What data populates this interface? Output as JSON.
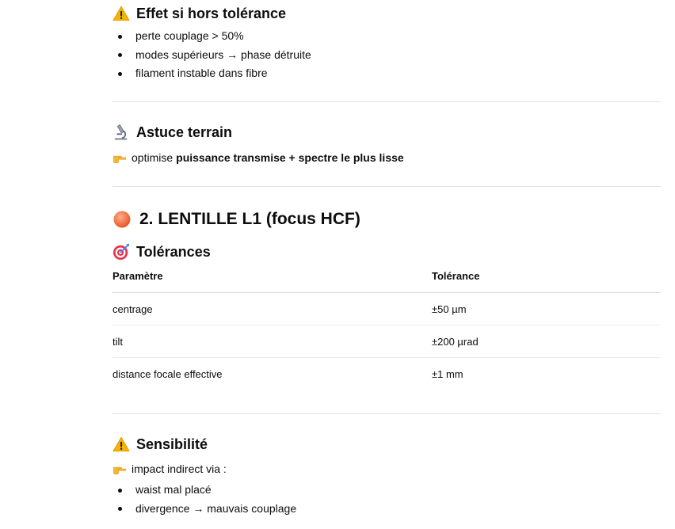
{
  "section_effect": {
    "title": "Effet si hors tolérance",
    "icon": "warning-icon",
    "items": [
      "perte couplage > 50%",
      "modes supérieurs → phase détruite",
      "filament instable dans fibre"
    ]
  },
  "section_tip": {
    "title": "Astuce terrain",
    "icon": "microscope-icon",
    "pointer_icon": "pointing-hand-icon",
    "text_prefix": "optimise ",
    "text_bold": "puissance transmise + spectre le plus lisse"
  },
  "section_lens": {
    "title": "2. LENTILLE L1 (focus HCF)",
    "icon": "orange-circle-icon"
  },
  "section_tolerances": {
    "title": "Tolérances",
    "icon": "target-icon",
    "headers": [
      "Paramètre",
      "Tolérance"
    ],
    "rows": [
      [
        "centrage",
        "±50 µm"
      ],
      [
        "tilt",
        "±200 µrad"
      ],
      [
        "distance focale effective",
        "±1 mm"
      ]
    ]
  },
  "section_sensitivity": {
    "title": "Sensibilité",
    "icon": "warning-icon",
    "pointer_icon": "pointing-hand-icon",
    "intro": "impact indirect via :",
    "items": [
      "waist mal placé",
      "divergence → mauvais couplage"
    ]
  },
  "colors": {
    "text": "#0d0d0d",
    "divider": "#e3e3e3",
    "warning": "#f5b400",
    "orange": "#f2784b",
    "hand": "#f7b733"
  }
}
